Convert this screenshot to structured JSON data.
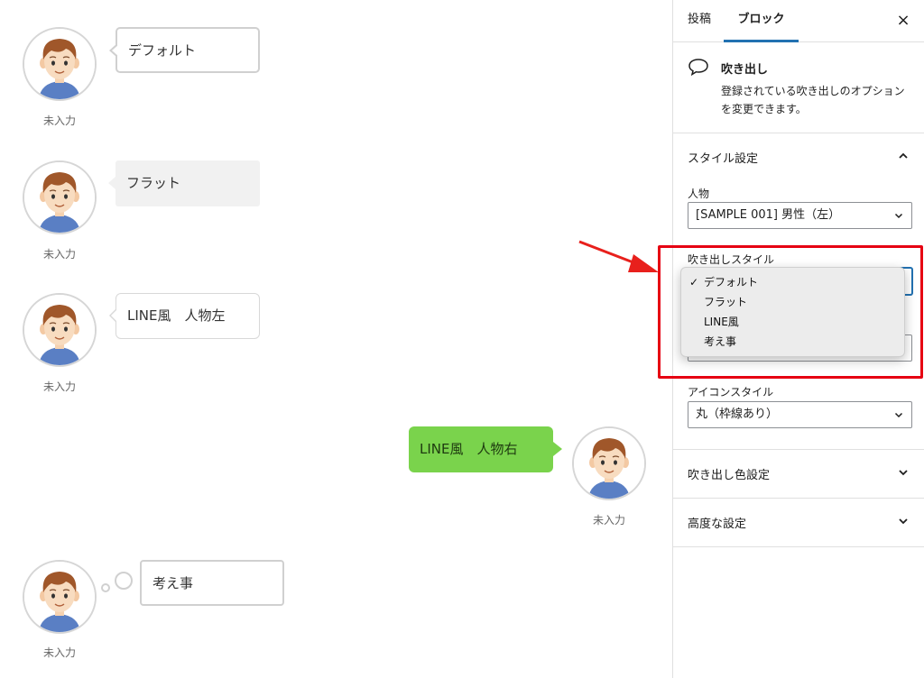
{
  "canvas": {
    "blocks": [
      {
        "style": "default",
        "text": "デフォルト",
        "name": "未入力"
      },
      {
        "style": "flat",
        "text": "フラット",
        "name": "未入力"
      },
      {
        "style": "line-left",
        "text": "LINE風　人物左",
        "name": "未入力"
      },
      {
        "style": "line-right",
        "text": "LINE風　人物右",
        "name": "未入力"
      },
      {
        "style": "think",
        "text": "考え事",
        "name": "未入力"
      }
    ]
  },
  "sidebar": {
    "tabs": {
      "post": "投稿",
      "block": "ブロック"
    },
    "close": "×",
    "block": {
      "icon": "speech-bubble-icon",
      "title": "吹き出し",
      "description": "登録されている吹き出しのオプションを変更できます。"
    },
    "style_panel": {
      "title": "スタイル設定",
      "person_label": "人物",
      "person_value": "[SAMPLE 001] 男性（左）",
      "bubble_style_label": "吹き出しスタイル",
      "bubble_style_options": [
        "デフォルト",
        "フラット",
        "LINE風",
        "考え事"
      ],
      "bubble_style_selected": "デフォルト",
      "icon_style_label": "アイコンスタイル",
      "icon_style_value": "丸（枠線あり）"
    },
    "color_panel": {
      "title": "吹き出し色設定"
    },
    "advanced_panel": {
      "title": "高度な設定"
    }
  },
  "colors": {
    "accent": "#2271b1",
    "highlight": "#e60012",
    "line_green": "#7ad34c"
  }
}
